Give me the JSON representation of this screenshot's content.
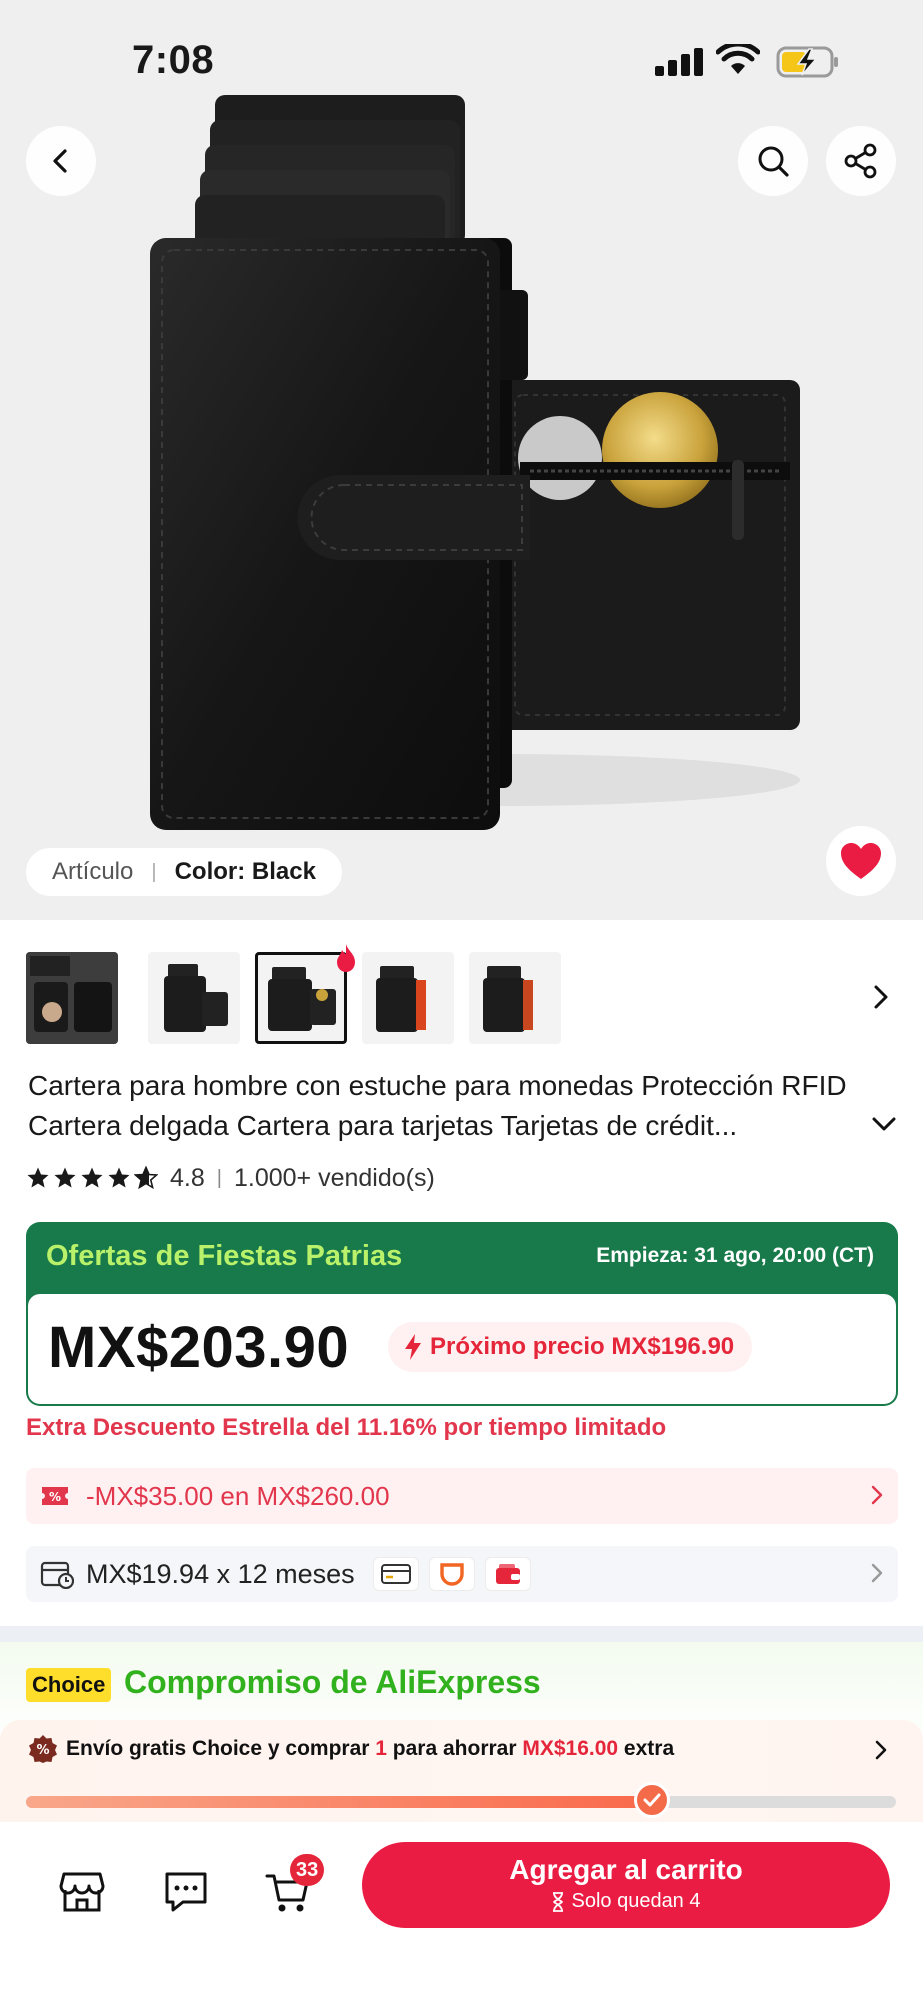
{
  "status_bar": {
    "time": "7:08"
  },
  "hero": {
    "variant_key": "Artículo",
    "variant_value": "Color: Black"
  },
  "thumbnails": [
    {
      "name": "thumb-1",
      "selected": false,
      "hot": false
    },
    {
      "name": "thumb-2",
      "selected": false,
      "hot": false
    },
    {
      "name": "thumb-3",
      "selected": true,
      "hot": true
    },
    {
      "name": "thumb-4",
      "selected": false,
      "hot": false
    },
    {
      "name": "thumb-5",
      "selected": false,
      "hot": false
    }
  ],
  "product": {
    "title": "Cartera para hombre con estuche para monedas Protección RFID Cartera delgada Cartera para tarjetas Tarjetas de crédit...",
    "rating": "4.8",
    "rating_stars": 4.8,
    "sold": "1.000+ vendido(s)"
  },
  "deal": {
    "name": "Ofertas de Fiestas Patrias",
    "start": "Empieza: 31 ago, 20:00 (CT)",
    "price": "MX$203.90",
    "next_price": "Próximo precio MX$196.90",
    "bg_color": "#187a4a"
  },
  "extra_discount": "Extra Descuento Estrella del 11.16% por tiempo limitado",
  "coupon": {
    "text": "-MX$35.00 en MX$260.00"
  },
  "installments": {
    "text": "MX$19.94 x 12 meses"
  },
  "choice": {
    "badge": "Choice",
    "title": "Compromiso de AliExpress",
    "ship_pre": "Envío gratis Choice y comprar ",
    "ship_qty": "1",
    "ship_mid": " para ahorrar ",
    "ship_amount": "MX$16.00",
    "ship_post": " extra",
    "progress": 0.72
  },
  "bottom_bar": {
    "cart_count": "33",
    "add_to_cart": "Agregar al carrito",
    "stock_note": "Solo quedan 4"
  },
  "colors": {
    "accent_red": "#ea1c43",
    "deal_green": "#187a4a",
    "choice_green": "#32b11e",
    "choice_yellow": "#ffdd2b"
  }
}
